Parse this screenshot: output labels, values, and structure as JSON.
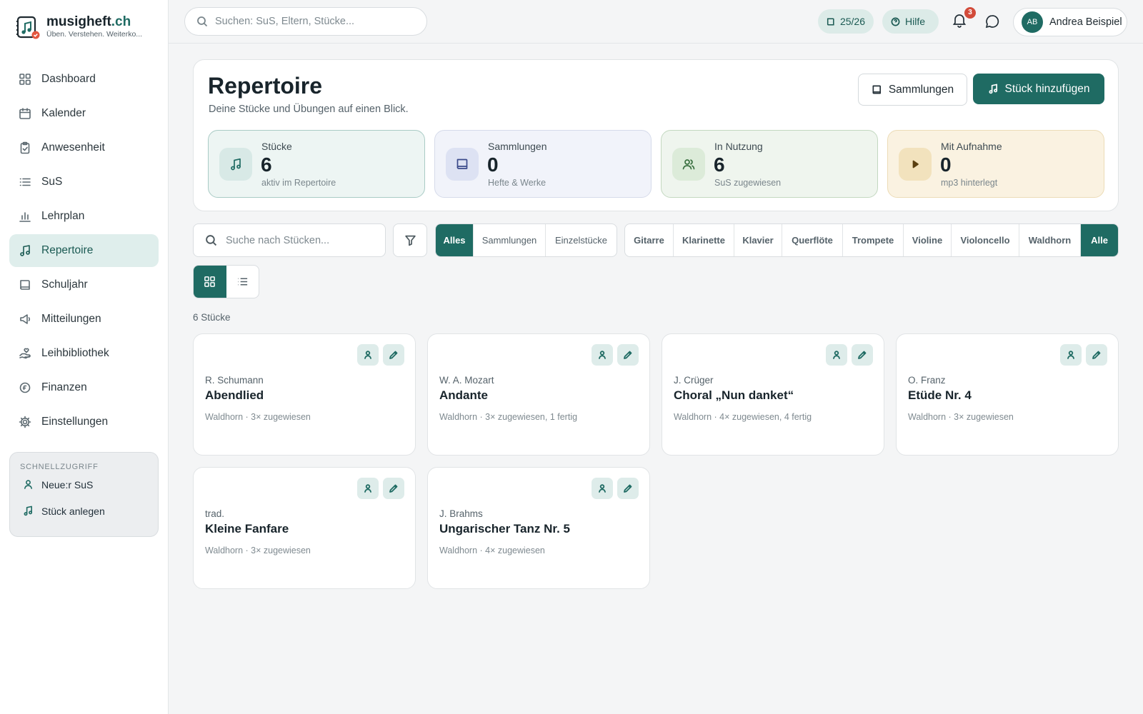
{
  "brand": {
    "name": "musigheft",
    "tld": ".ch",
    "tagline": "Üben. Verstehen. Weiterko..."
  },
  "sidebar": {
    "items": [
      {
        "label": "Dashboard",
        "icon": "grid-icon"
      },
      {
        "label": "Kalender",
        "icon": "calendar-icon"
      },
      {
        "label": "Anwesenheit",
        "icon": "clipboard-check-icon"
      },
      {
        "label": "SuS",
        "icon": "list-icon"
      },
      {
        "label": "Lehrplan",
        "icon": "bar-chart-icon"
      },
      {
        "label": "Repertoire",
        "icon": "music-note-icon",
        "active": true
      },
      {
        "label": "Schuljahr",
        "icon": "book-icon"
      },
      {
        "label": "Mitteilungen",
        "icon": "megaphone-icon"
      },
      {
        "label": "Leihbibliothek",
        "icon": "hand-heart-icon"
      },
      {
        "label": "Finanzen",
        "icon": "coin-icon"
      },
      {
        "label": "Einstellungen",
        "icon": "gear-icon"
      }
    ],
    "quick": {
      "title": "SCHNELLZUGRIFF",
      "items": [
        {
          "label": "Neue:r SuS",
          "icon": "user-icon"
        },
        {
          "label": "Stück anlegen",
          "icon": "music-note-icon"
        }
      ]
    }
  },
  "topbar": {
    "search_placeholder": "Suchen: SuS, Eltern, Stücke...",
    "school_year": "25/26",
    "help": "Hilfe",
    "notifications": "3",
    "user": {
      "initials": "AB",
      "name": "Andrea Beispiel"
    }
  },
  "header": {
    "title": "Repertoire",
    "subtitle": "Deine Stücke und Übungen auf einen Blick.",
    "btn_collections": "Sammlungen",
    "btn_add": "Stück hinzufügen"
  },
  "stats": [
    {
      "label": "Stücke",
      "value": "6",
      "sub": "aktiv im Repertoire",
      "icon": "music-note-icon"
    },
    {
      "label": "Sammlungen",
      "value": "0",
      "sub": "Hefte & Werke",
      "icon": "book-icon"
    },
    {
      "label": "In Nutzung",
      "value": "6",
      "sub": "SuS zugewiesen",
      "icon": "users-icon"
    },
    {
      "label": "Mit Aufnahme",
      "value": "0",
      "sub": "mp3 hinterlegt",
      "icon": "play-icon"
    }
  ],
  "filters": {
    "search_placeholder": "Suche nach Stücken...",
    "type_options": [
      "Alles",
      "Sammlungen",
      "Einzelstücke"
    ],
    "type_selected": "Alles",
    "instruments": [
      "Gitarre",
      "Klarinette",
      "Klavier",
      "Querflöte",
      "Trompete",
      "Violine",
      "Violoncello",
      "Waldhorn",
      "Alle"
    ],
    "instrument_selected": "Alle",
    "view_selected": "grid"
  },
  "count_label": "6 Stücke",
  "pieces": [
    {
      "composer": "R. Schumann",
      "title": "Abendlied",
      "meta": "Waldhorn · 3× zugewiesen"
    },
    {
      "composer": "W. A. Mozart",
      "title": "Andante",
      "meta": "Waldhorn · 3× zugewiesen, 1 fertig"
    },
    {
      "composer": "J. Crüger",
      "title": "Choral „Nun danket“",
      "meta": "Waldhorn · 4× zugewiesen, 4 fertig"
    },
    {
      "composer": "O. Franz",
      "title": "Etüde Nr. 4",
      "meta": "Waldhorn · 3× zugewiesen"
    },
    {
      "composer": "trad.",
      "title": "Kleine Fanfare",
      "meta": "Waldhorn · 3× zugewiesen"
    },
    {
      "composer": "J. Brahms",
      "title": "Ungarischer Tanz Nr. 5",
      "meta": "Waldhorn · 4× zugewiesen"
    }
  ],
  "colors": {
    "accent": "#1f6b63",
    "accent_light": "#dfeeec",
    "badge": "#d24b3a"
  }
}
